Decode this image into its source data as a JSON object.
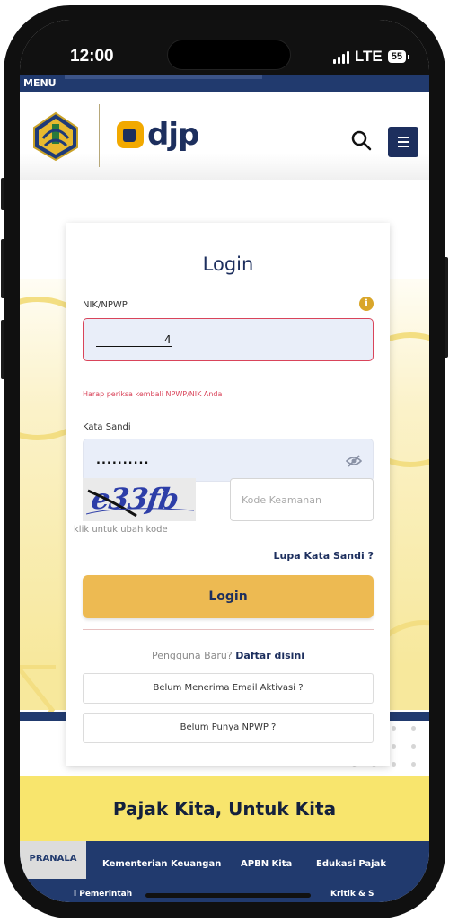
{
  "status_bar": {
    "time": "12:00",
    "network": "LTE",
    "battery": "55"
  },
  "top_menu": {
    "label": "MENU"
  },
  "header": {
    "logo_text": "djp",
    "search_icon": "search-icon",
    "menu_icon": "hamburger-icon"
  },
  "login": {
    "title": "Login",
    "nik_label": "NIK/NPWP",
    "nik_value": "4",
    "nik_error": "Harap periksa kembali NPWP/NIK Anda",
    "password_label": "Kata Sandi",
    "password_value": "..........",
    "captcha_text": "e33fb",
    "captcha_hint": "klik untuk ubah kode",
    "code_placeholder": "Kode Keamanan",
    "forgot_label": "Lupa Kata Sandi ?",
    "submit_label": "Login",
    "new_user_text": "Pengguna Baru?",
    "register_link": "Daftar disini",
    "resend_activation": "Belum Menerima Email Aktivasi ?",
    "no_npwp": "Belum Punya NPWP ?"
  },
  "tagline": "Pajak Kita, Untuk Kita",
  "footer": {
    "active_tab": "PRANALA",
    "links": [
      "Kementerian Keuangan",
      "APBN Kita",
      "Edukasi Pajak"
    ],
    "partial_links": [
      "i Pemerintah",
      "Kritik & S"
    ]
  },
  "colors": {
    "navy": "#213a6e",
    "gold": "#edba52",
    "error": "#d9445a",
    "tagline_band": "#f8e56d"
  }
}
